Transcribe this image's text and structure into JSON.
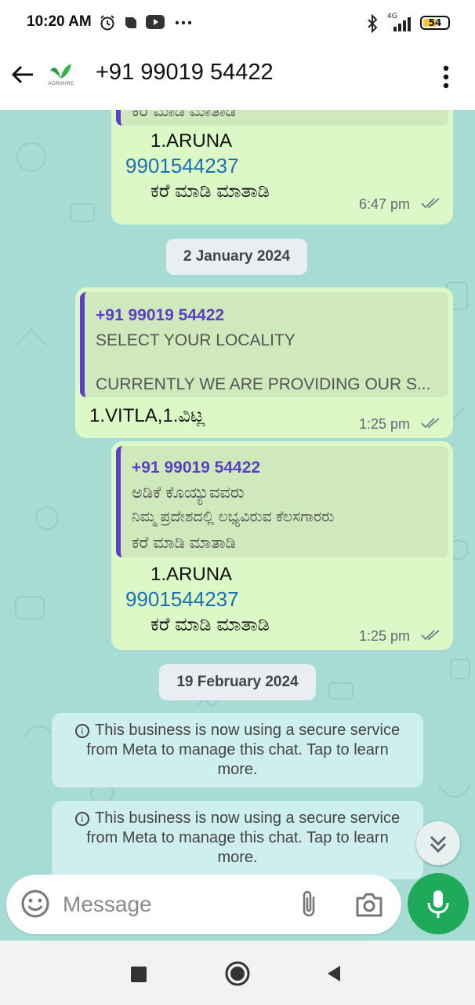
{
  "status_bar": {
    "time": "10:20 AM",
    "battery": "54",
    "network": "4G",
    "icons": [
      "alarm-icon",
      "notification-icon",
      "youtube-icon",
      "more-icon",
      "bluetooth-icon",
      "signal-icon",
      "battery-icon"
    ]
  },
  "header": {
    "contact": "+91 99019 54422",
    "logo_text": "AGRIHIRE"
  },
  "messages": {
    "m1": {
      "quote_partial": "ಕರೆ ಮಾಡಿ ಮಾತಾಡಿ",
      "line1": "1.ARUNA",
      "phone": "9901544237",
      "line3": "ಕರೆ ಮಾಡಿ ಮಾತಾಡಿ",
      "time": "6:47 pm"
    },
    "date1": "2 January 2024",
    "m2": {
      "quote_name": "+91 99019 54422",
      "quote_line1": "SELECT YOUR LOCALITY",
      "quote_line2": "CURRENTLY WE ARE PROVIDING OUR S...",
      "text": "1.VITLA,1.ವಿಟ್ಲ",
      "time": "1:25 pm"
    },
    "m3": {
      "quote_name": "+91 99019 54422",
      "quote_line1": "ಅಡಿಕೆ ಕೊಯ್ಯುವವರು",
      "quote_line2": "ನಿಮ್ಮ ಪ್ರದೇಶದಲ್ಲಿ ಲಭ್ಯವಿರುವ ಕೆಲಸಗಾರರು",
      "quote_line3": "ಕರೆ ಮಾಡಿ ಮಾತಾಡಿ",
      "line1": "1.ARUNA",
      "phone": "9901544237",
      "line3": "ಕರೆ ಮಾಡಿ ಮಾತಾಡಿ",
      "time": "1:25 pm"
    },
    "date2": "19 February 2024",
    "system1": "This business is now using a secure service from Meta to manage this chat. Tap to learn more.",
    "system2": "This business is now using a secure service from Meta to manage this chat. Tap to learn more."
  },
  "input": {
    "placeholder": "Message"
  },
  "colors": {
    "outgoing_bubble": "#dcf8c6",
    "chat_background": "#a6dcd4",
    "quote_accent": "#5b3fc4",
    "link": "#1c6fb0",
    "mic_button": "#1faa59"
  }
}
